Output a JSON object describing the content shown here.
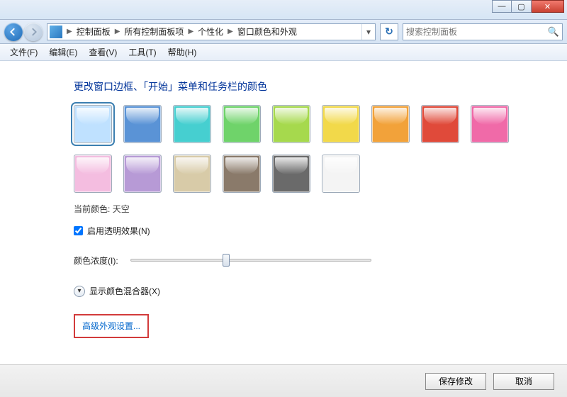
{
  "titlebar": {
    "min": "—",
    "max": "▢",
    "close": "✕"
  },
  "nav": {
    "breadcrumb": [
      "控制面板",
      "所有控制面板项",
      "个性化",
      "窗口颜色和外观"
    ],
    "search_placeholder": "搜索控制面板"
  },
  "menu": [
    "文件(F)",
    "编辑(E)",
    "查看(V)",
    "工具(T)",
    "帮助(H)"
  ],
  "heading": "更改窗口边框、「开始」菜单和任务栏的颜色",
  "swatches": [
    {
      "color": "#bfe1ff",
      "selected": true
    },
    {
      "color": "#5a93d6"
    },
    {
      "color": "#46cfd0"
    },
    {
      "color": "#6fd36a"
    },
    {
      "color": "#a6d94d"
    },
    {
      "color": "#f2d94a"
    },
    {
      "color": "#f2a23a"
    },
    {
      "color": "#e04a3a"
    },
    {
      "color": "#f06aa8"
    },
    {
      "color": "#f4bde0"
    },
    {
      "color": "#b79ad6"
    },
    {
      "color": "#d8cba8"
    },
    {
      "color": "#8a7a6a"
    },
    {
      "color": "#6a6a6a"
    },
    {
      "color": "#f4f4f4"
    }
  ],
  "current_color": {
    "label": "当前颜色:",
    "value": "天空"
  },
  "transparency": {
    "label": "启用透明效果(N)",
    "checked": true
  },
  "intensity_label": "颜色浓度(I):",
  "mixer_label": "显示颜色混合器(X)",
  "advanced_link": "高级外观设置...",
  "buttons": {
    "save": "保存修改",
    "cancel": "取消"
  }
}
